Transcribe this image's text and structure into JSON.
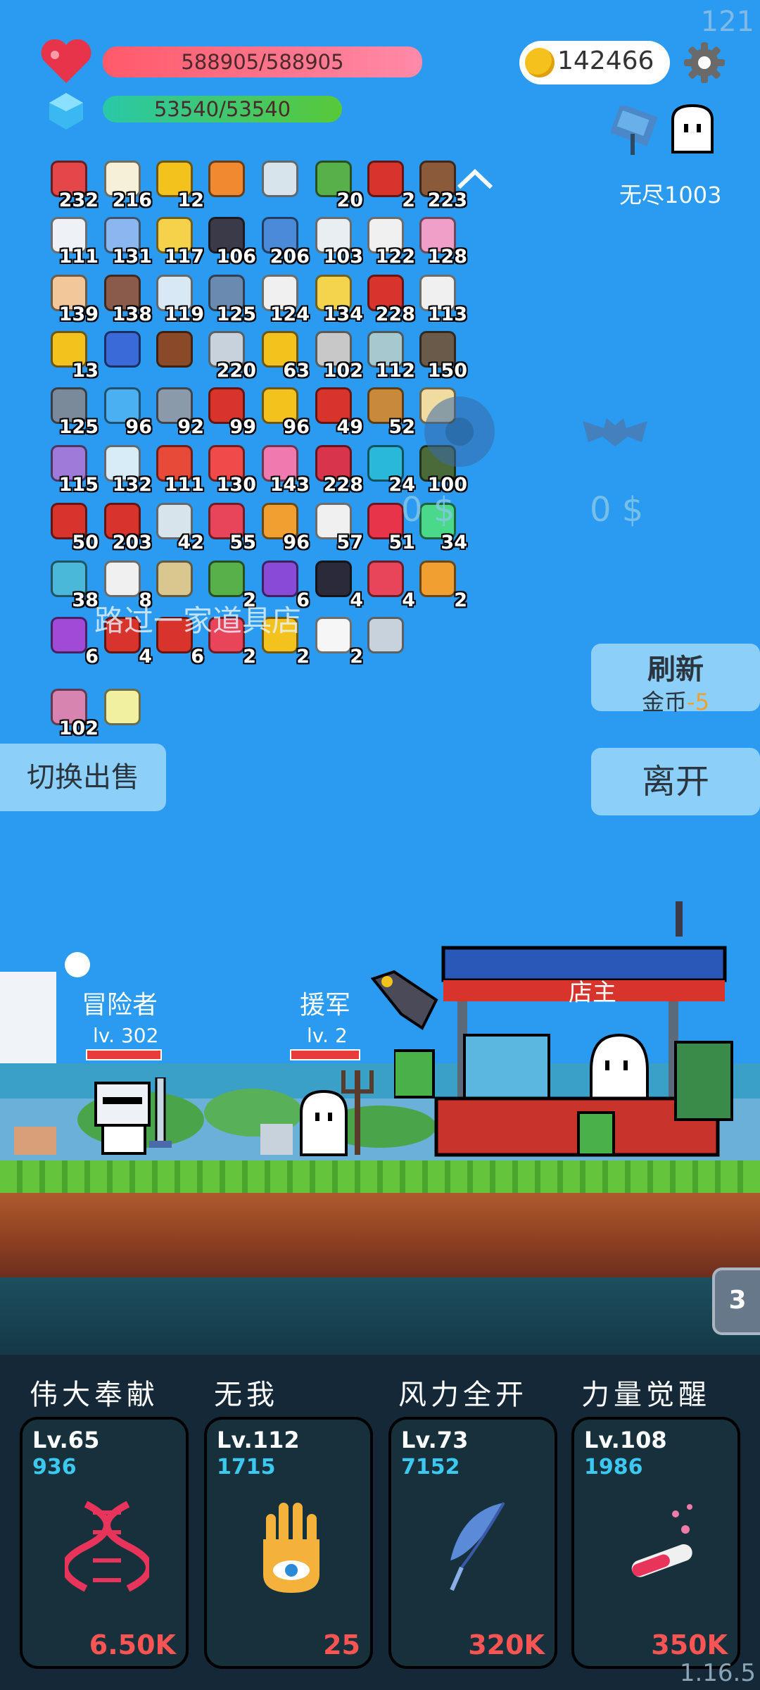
{
  "fps": "121",
  "version": "1.16.5",
  "player": {
    "hp_text": "588905/588905",
    "mana_text": "53540/53540"
  },
  "gold": "142466",
  "mode_label": "无尽1003",
  "shop": {
    "title": "路过一家道具店",
    "price_left": "0 $",
    "price_right": "0 $",
    "refresh_label": "刷新",
    "refresh_cost_label": "金币",
    "refresh_cost_value": "-5",
    "leave_label": "离开",
    "switch_label": "切换出售"
  },
  "inventory": {
    "rows": [
      [
        {
          "icon": "watermelon-icon",
          "count": "232",
          "color": "#e4464a"
        },
        {
          "icon": "fried-egg-icon",
          "count": "216",
          "color": "#f6f0d8"
        },
        {
          "icon": "crown-icon",
          "count": "12",
          "color": "#f4c21c"
        },
        {
          "icon": "map-book-icon",
          "count": "",
          "color": "#f08a30"
        },
        {
          "icon": "magnifier-icon",
          "count": "",
          "color": "#d8e4ec"
        },
        {
          "icon": "money-heart-icon",
          "count": "20",
          "color": "#58b04a"
        },
        {
          "icon": "magnet-icon",
          "count": "2",
          "color": "#d8342c"
        },
        {
          "icon": "shield-round-icon",
          "count": "223",
          "color": "#8a5a3a"
        }
      ],
      [
        {
          "icon": "clipboard-icon",
          "count": "111",
          "color": "#eef2f6"
        },
        {
          "icon": "eraser-icon",
          "count": "131",
          "color": "#8cb6f0"
        },
        {
          "icon": "note-pencil-icon",
          "count": "117",
          "color": "#f6d24a"
        },
        {
          "icon": "cauldron-icon",
          "count": "106",
          "color": "#3a3a48"
        },
        {
          "icon": "star-card-icon",
          "count": "206",
          "color": "#4a8ad8"
        },
        {
          "icon": "hermit-crab-icon",
          "count": "103",
          "color": "#e8eef2"
        },
        {
          "icon": "flag-icon",
          "count": "122",
          "color": "#f0f0f0"
        },
        {
          "icon": "ice-cream-icon",
          "count": "128",
          "color": "#f0a0c8"
        }
      ],
      [
        {
          "icon": "fist-icon",
          "count": "139",
          "color": "#f2c89a"
        },
        {
          "icon": "helmet-icon",
          "count": "138",
          "color": "#8a5a4a"
        },
        {
          "icon": "halo-wings-icon",
          "count": "119",
          "color": "#d8e8f4"
        },
        {
          "icon": "shield-icon",
          "count": "125",
          "color": "#6a8ab0"
        },
        {
          "icon": "dice-icon",
          "count": "124",
          "color": "#f0f0f0"
        },
        {
          "icon": "egg-icon",
          "count": "134",
          "color": "#f4d44c"
        },
        {
          "icon": "sock-icon",
          "count": "228",
          "color": "#d8342c"
        },
        {
          "icon": "cards-icon",
          "count": "113",
          "color": "#f0f0f0"
        }
      ],
      [
        {
          "icon": "sun-cloud-icon",
          "count": "13",
          "color": "#f4c21c"
        },
        {
          "icon": "tarot-icon",
          "count": "",
          "color": "#3a6ad8"
        },
        {
          "icon": "chest-icon",
          "count": "",
          "color": "#8a4a2a"
        },
        {
          "icon": "sword-icon",
          "count": "220",
          "color": "#c8d2dc"
        },
        {
          "icon": "ring-icon",
          "count": "63",
          "color": "#f4c21c"
        },
        {
          "icon": "meteor-icon",
          "count": "102",
          "color": "#c8c8c8"
        },
        {
          "icon": "disc-icon",
          "count": "112",
          "color": "#a8c8d0"
        },
        {
          "icon": "bag-icon",
          "count": "150",
          "color": "#6a5a4a"
        }
      ],
      [
        {
          "icon": "spiked-ball-icon",
          "count": "125",
          "color": "#7a8a9a"
        },
        {
          "icon": "chat-bubble-icon",
          "count": "96",
          "color": "#4ab0f0"
        },
        {
          "icon": "brain-icon",
          "count": "92",
          "color": "#8a9aaa"
        },
        {
          "icon": "red-shield-icon",
          "count": "99",
          "color": "#d8342c"
        },
        {
          "icon": "sunflower-icon",
          "count": "96",
          "color": "#f4c21c"
        },
        {
          "icon": "heart-icon",
          "count": "49",
          "color": "#d8342c"
        },
        {
          "icon": "bow-icon",
          "count": "52",
          "color": "#c88a3a"
        },
        {
          "icon": "treasure-map-icon",
          "count": "",
          "color": "#f0dca0"
        }
      ],
      [
        {
          "icon": "star-shield-icon",
          "count": "115",
          "color": "#a07ad8"
        },
        {
          "icon": "snowball-icon",
          "count": "132",
          "color": "#d8ecf8"
        },
        {
          "icon": "gift-icon",
          "count": "111",
          "color": "#e84a3a"
        },
        {
          "icon": "pill-icon",
          "count": "130",
          "color": "#f04a4a"
        },
        {
          "icon": "potion-icon",
          "count": "143",
          "color": "#f07ab0"
        },
        {
          "icon": "jam-jar-icon",
          "count": "228",
          "color": "#d8344c"
        },
        {
          "icon": "gem-icon",
          "count": "24",
          "color": "#2ab8d8"
        },
        {
          "icon": "grenade-icon",
          "count": "100",
          "color": "#4a6a3a"
        }
      ],
      [
        {
          "icon": "mushroom-stick-icon",
          "count": "50",
          "color": "#d8342c"
        },
        {
          "icon": "apple-icon",
          "count": "203",
          "color": "#d8342c"
        },
        {
          "icon": "crosshair-icon",
          "count": "42",
          "color": "#d8e4ec"
        },
        {
          "icon": "heart-big-icon",
          "count": "55",
          "color": "#e8445a"
        },
        {
          "icon": "tome-icon",
          "count": "96",
          "color": "#f0a030"
        },
        {
          "icon": "cloud-icon",
          "count": "57",
          "color": "#f0f0f0"
        },
        {
          "icon": "strawberry-icon",
          "count": "51",
          "color": "#e8344a"
        },
        {
          "icon": "slime-icon",
          "count": "34",
          "color": "#4ad88a"
        }
      ],
      [
        {
          "icon": "scroll-icon",
          "count": "38",
          "color": "#4ab8d8"
        },
        {
          "icon": "envelope-icon",
          "count": "8",
          "color": "#f0f0f0"
        },
        {
          "icon": "noose-icon",
          "count": "",
          "color": "#d8c890"
        },
        {
          "icon": "lime-icon",
          "count": "2",
          "color": "#58b04a"
        },
        {
          "icon": "purple-box-icon",
          "count": "6",
          "color": "#8a4ad8"
        },
        {
          "icon": "bat-icon",
          "count": "4",
          "color": "#2a2a3a"
        },
        {
          "icon": "steak-icon",
          "count": "4",
          "color": "#e8445a"
        },
        {
          "icon": "orange-scroll-icon",
          "count": "2",
          "color": "#f0a030"
        }
      ],
      [
        {
          "icon": "crystal-ball-icon",
          "count": "6",
          "color": "#a04ad8"
        },
        {
          "icon": "thermometer-icon",
          "count": "4",
          "color": "#d8342c"
        },
        {
          "icon": "bookmark-icon",
          "count": "6",
          "color": "#d8342c"
        },
        {
          "icon": "mushroom-icon",
          "count": "2",
          "color": "#e8445a"
        },
        {
          "icon": "magic-wand-icon",
          "count": "2",
          "color": "#f4c21c"
        },
        {
          "icon": "ghost-icon",
          "count": "2",
          "color": "#f6f6f6"
        },
        {
          "icon": "compass-icon",
          "count": "",
          "color": "#c8d2dc"
        }
      ],
      [
        {
          "icon": "pink-crate-icon",
          "count": "102",
          "color": "#d884b0"
        },
        {
          "icon": "lightbulb-icon",
          "count": "",
          "color": "#f0f0a0"
        }
      ]
    ]
  },
  "battle": {
    "adventurer_name": "冒险者",
    "adventurer_level": "lv. 302",
    "ally_name": "援军",
    "ally_level": "lv. 2",
    "shopkeeper_name": "店主",
    "wave_number": "3"
  },
  "skills": [
    {
      "title": "伟大奉献",
      "level": "Lv.65",
      "value": "936",
      "cost": "6.50K",
      "icon": "dna-icon"
    },
    {
      "title": "无我",
      "level": "Lv.112",
      "value": "1715",
      "cost": "25",
      "icon": "eye-hand-icon"
    },
    {
      "title": "风力全开",
      "level": "Lv.73",
      "value": "7152",
      "cost": "320K",
      "icon": "feather-icon"
    },
    {
      "title": "力量觉醒",
      "level": "Lv.108",
      "value": "1986",
      "cost": "350K",
      "icon": "test-tube-icon"
    }
  ],
  "colors": {
    "sky": "#2a9bf0",
    "hp_bar": "#ff6b8a",
    "mana_bar": "#4ad05a",
    "cost_red": "#ff5454",
    "skill_value_cyan": "#3cc8f0"
  }
}
